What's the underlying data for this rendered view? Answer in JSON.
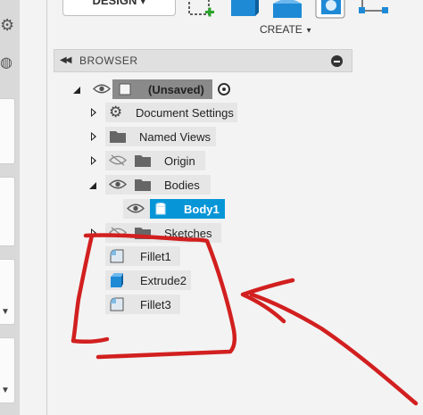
{
  "toolbar": {
    "design_label": "DESIGN ▾",
    "create_label": "CREATE",
    "icons": [
      "sketch-icon",
      "box-icon",
      "extrude-icon",
      "shell-icon",
      "more-icon"
    ]
  },
  "browser": {
    "title": "BROWSER",
    "root": {
      "label": "(Unsaved)"
    },
    "items": [
      {
        "label": "Document Settings",
        "icon": "gear-icon"
      },
      {
        "label": "Named Views",
        "icon": "folder-icon"
      },
      {
        "label": "Origin",
        "icon": "folder-icon",
        "hidden": true
      },
      {
        "label": "Bodies",
        "icon": "folder-icon",
        "expanded": true
      },
      {
        "label": "Body1",
        "icon": "body-icon",
        "selected": true
      },
      {
        "label": "Sketches",
        "icon": "folder-icon",
        "hidden": true
      },
      {
        "label": "Fillet1",
        "icon": "fillet-icon"
      },
      {
        "label": "Extrude2",
        "icon": "extrude-icon"
      },
      {
        "label": "Fillet3",
        "icon": "fillet-icon"
      }
    ]
  },
  "colors": {
    "selection": "#0696d7",
    "annotation": "#d21f1f",
    "panel_bg": "#f3f3f3"
  }
}
